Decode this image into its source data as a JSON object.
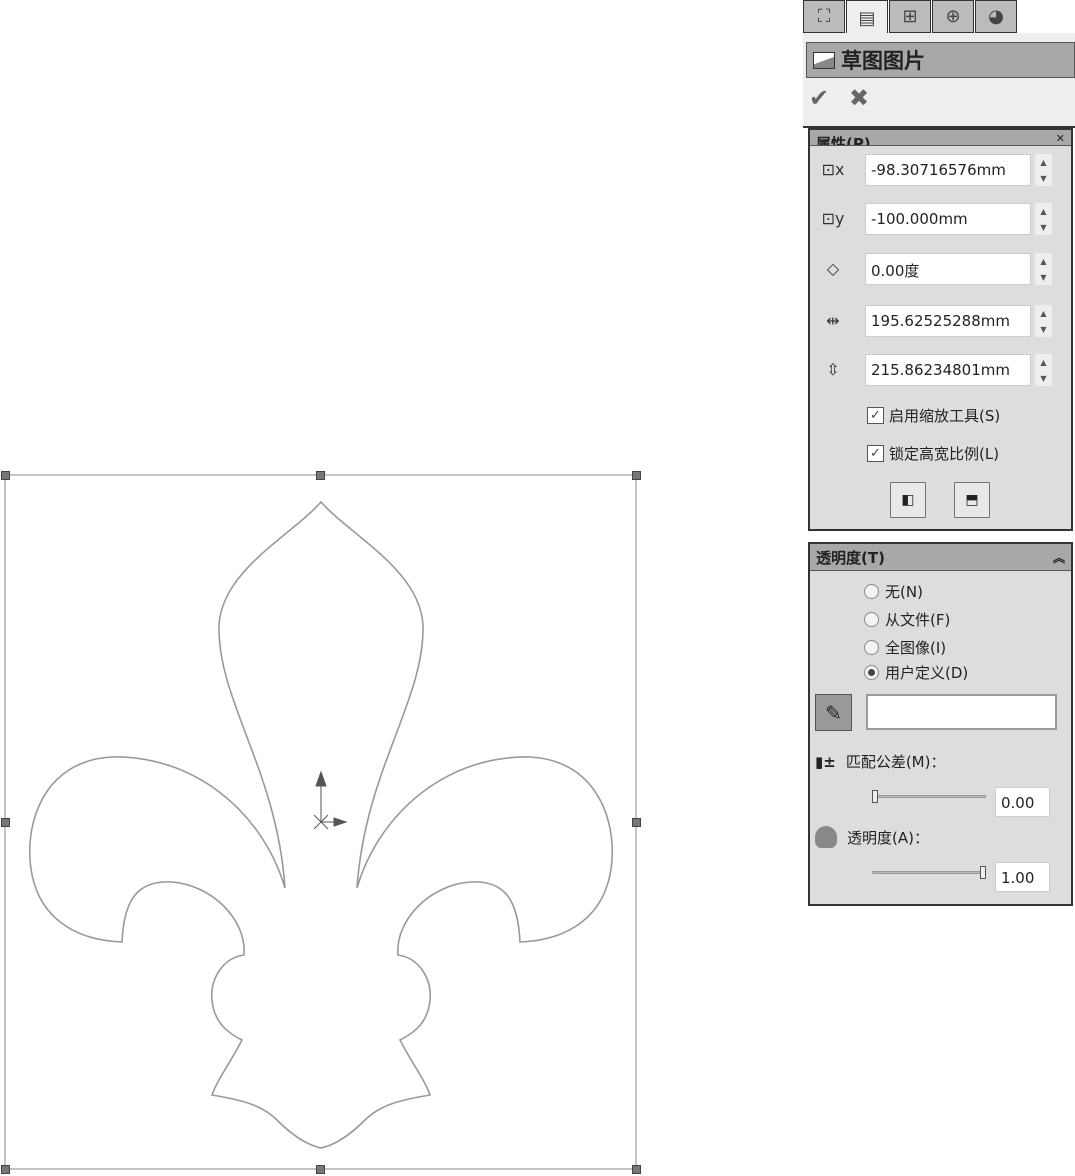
{
  "panel": {
    "tabs": [
      {
        "icon": "feature-manager-icon"
      },
      {
        "icon": "property-manager-icon"
      },
      {
        "icon": "configuration-manager-icon"
      },
      {
        "icon": "dimxpert-icon"
      },
      {
        "icon": "display-manager-icon"
      }
    ],
    "title": "草图图片",
    "properties": {
      "header": "属性(P)",
      "x_position": "-98.30716576mm",
      "y_position": "-100.000mm",
      "angle": "0.00度",
      "width": "195.62525288mm",
      "height": "215.86234801mm",
      "enable_scale_tool": {
        "label": "启用缩放工具(S)",
        "checked": true
      },
      "lock_aspect_ratio": {
        "label": "锁定高宽比例(L)",
        "checked": true
      }
    },
    "transparency": {
      "header": "透明度(T)",
      "options": [
        {
          "label": "无(N)",
          "selected": false
        },
        {
          "label": "从文件(F)",
          "selected": false
        },
        {
          "label": "全图像(I)",
          "selected": false
        },
        {
          "label": "用户定义(D)",
          "selected": true
        }
      ],
      "color_value": "",
      "tolerance_label": "匹配公差(M)：",
      "tolerance_value": "0.00",
      "tolerance_fraction": 0,
      "transparency_label": "透明度(A)：",
      "transparency_value": "1.00",
      "transparency_fraction": 1
    }
  }
}
